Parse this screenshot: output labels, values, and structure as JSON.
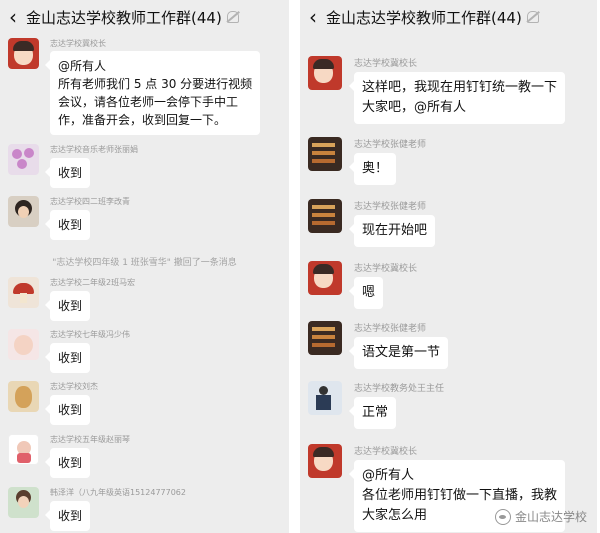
{
  "left": {
    "title": "金山志达学校教师工作群(44)",
    "back_icon": "back-chevron-icon",
    "mute_icon": "bell-off-icon",
    "messages": [
      {
        "sender": "志达学校冀校长",
        "lines": [
          "@所有人",
          "所有老师我们 5 点 30 分要进行视频",
          "会议，请各位老师一会停下手中工",
          "作，准备开会，收到回复一下。"
        ]
      },
      {
        "sender": "志达学校音乐老师张丽娟",
        "text": "收到"
      },
      {
        "sender": "志达学校四二班李改青",
        "text": "收到"
      },
      {
        "sender": "志达学校二年级2班马宏",
        "text": "收到"
      },
      {
        "sender": "志达学校七年级冯少伟",
        "text": "收到"
      },
      {
        "sender": "志达学校刘杰",
        "text": "收到"
      },
      {
        "sender": "志达学校五年级赵丽琴",
        "text": "收到"
      },
      {
        "sender": "韩泽洋（八九年级英语15124777062",
        "text": "收到"
      }
    ],
    "system_notice": "\"志达学校四年级 1 班张雪华\" 撤回了一条消息"
  },
  "right": {
    "title": "金山志达学校教师工作群(44)",
    "back_icon": "back-chevron-icon",
    "mute_icon": "bell-off-icon",
    "messages": [
      {
        "sender": "志达学校冀校长",
        "lines": [
          "这样吧，我现在用钉钉统一教一下",
          "大家吧，@所有人"
        ]
      },
      {
        "sender": "志达学校张健老师",
        "text": "奥！"
      },
      {
        "sender": "志达学校张健老师",
        "text": "现在开始吧"
      },
      {
        "sender": "志达学校冀校长",
        "text": "嗯"
      },
      {
        "sender": "志达学校张健老师",
        "text": "语文是第一节"
      },
      {
        "sender": "志达学校教务处王主任",
        "text": "正常"
      },
      {
        "sender": "志达学校冀校长",
        "lines": [
          "@所有人",
          "各位老师用钉钉做一下直播，我教",
          "大家怎么用"
        ]
      }
    ]
  },
  "watermark": "金山志达学校"
}
